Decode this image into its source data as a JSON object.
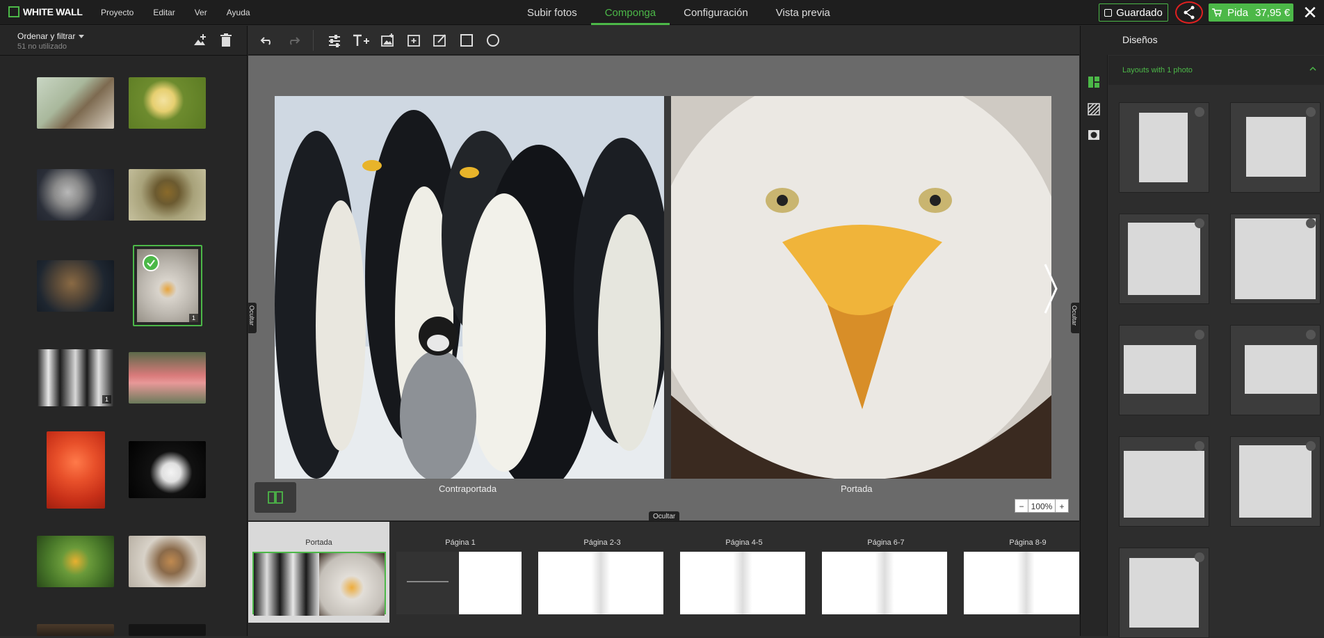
{
  "header": {
    "logo_text": "WHITE WALL",
    "menu": [
      "Proyecto",
      "Editar",
      "Ver",
      "Ayuda"
    ],
    "tabs": [
      "Subir fotos",
      "Componga",
      "Configuración",
      "Vista previa"
    ],
    "active_tab": "Componga",
    "saved_label": "Guardado",
    "order_label": "Pida",
    "order_price": "37,95 €",
    "accent_color": "#4cb848"
  },
  "left_panel": {
    "sort_label": "Ordenar y filtrar",
    "unused_count": "51 no utilizado",
    "selected_count": "1",
    "penguin_count": "1"
  },
  "canvas": {
    "back_label": "Contraportada",
    "front_label": "Portada",
    "hide_label": "Ocultar",
    "zoom": "100%",
    "zoom_minus": "−",
    "zoom_plus": "+"
  },
  "filmstrip": {
    "items": [
      "Portada",
      "Página 1",
      "Página 2-3",
      "Página 4-5",
      "Página 6-7",
      "Página 8-9"
    ]
  },
  "right_panel": {
    "title": "Diseños",
    "section": "Layouts with 1 photo"
  }
}
